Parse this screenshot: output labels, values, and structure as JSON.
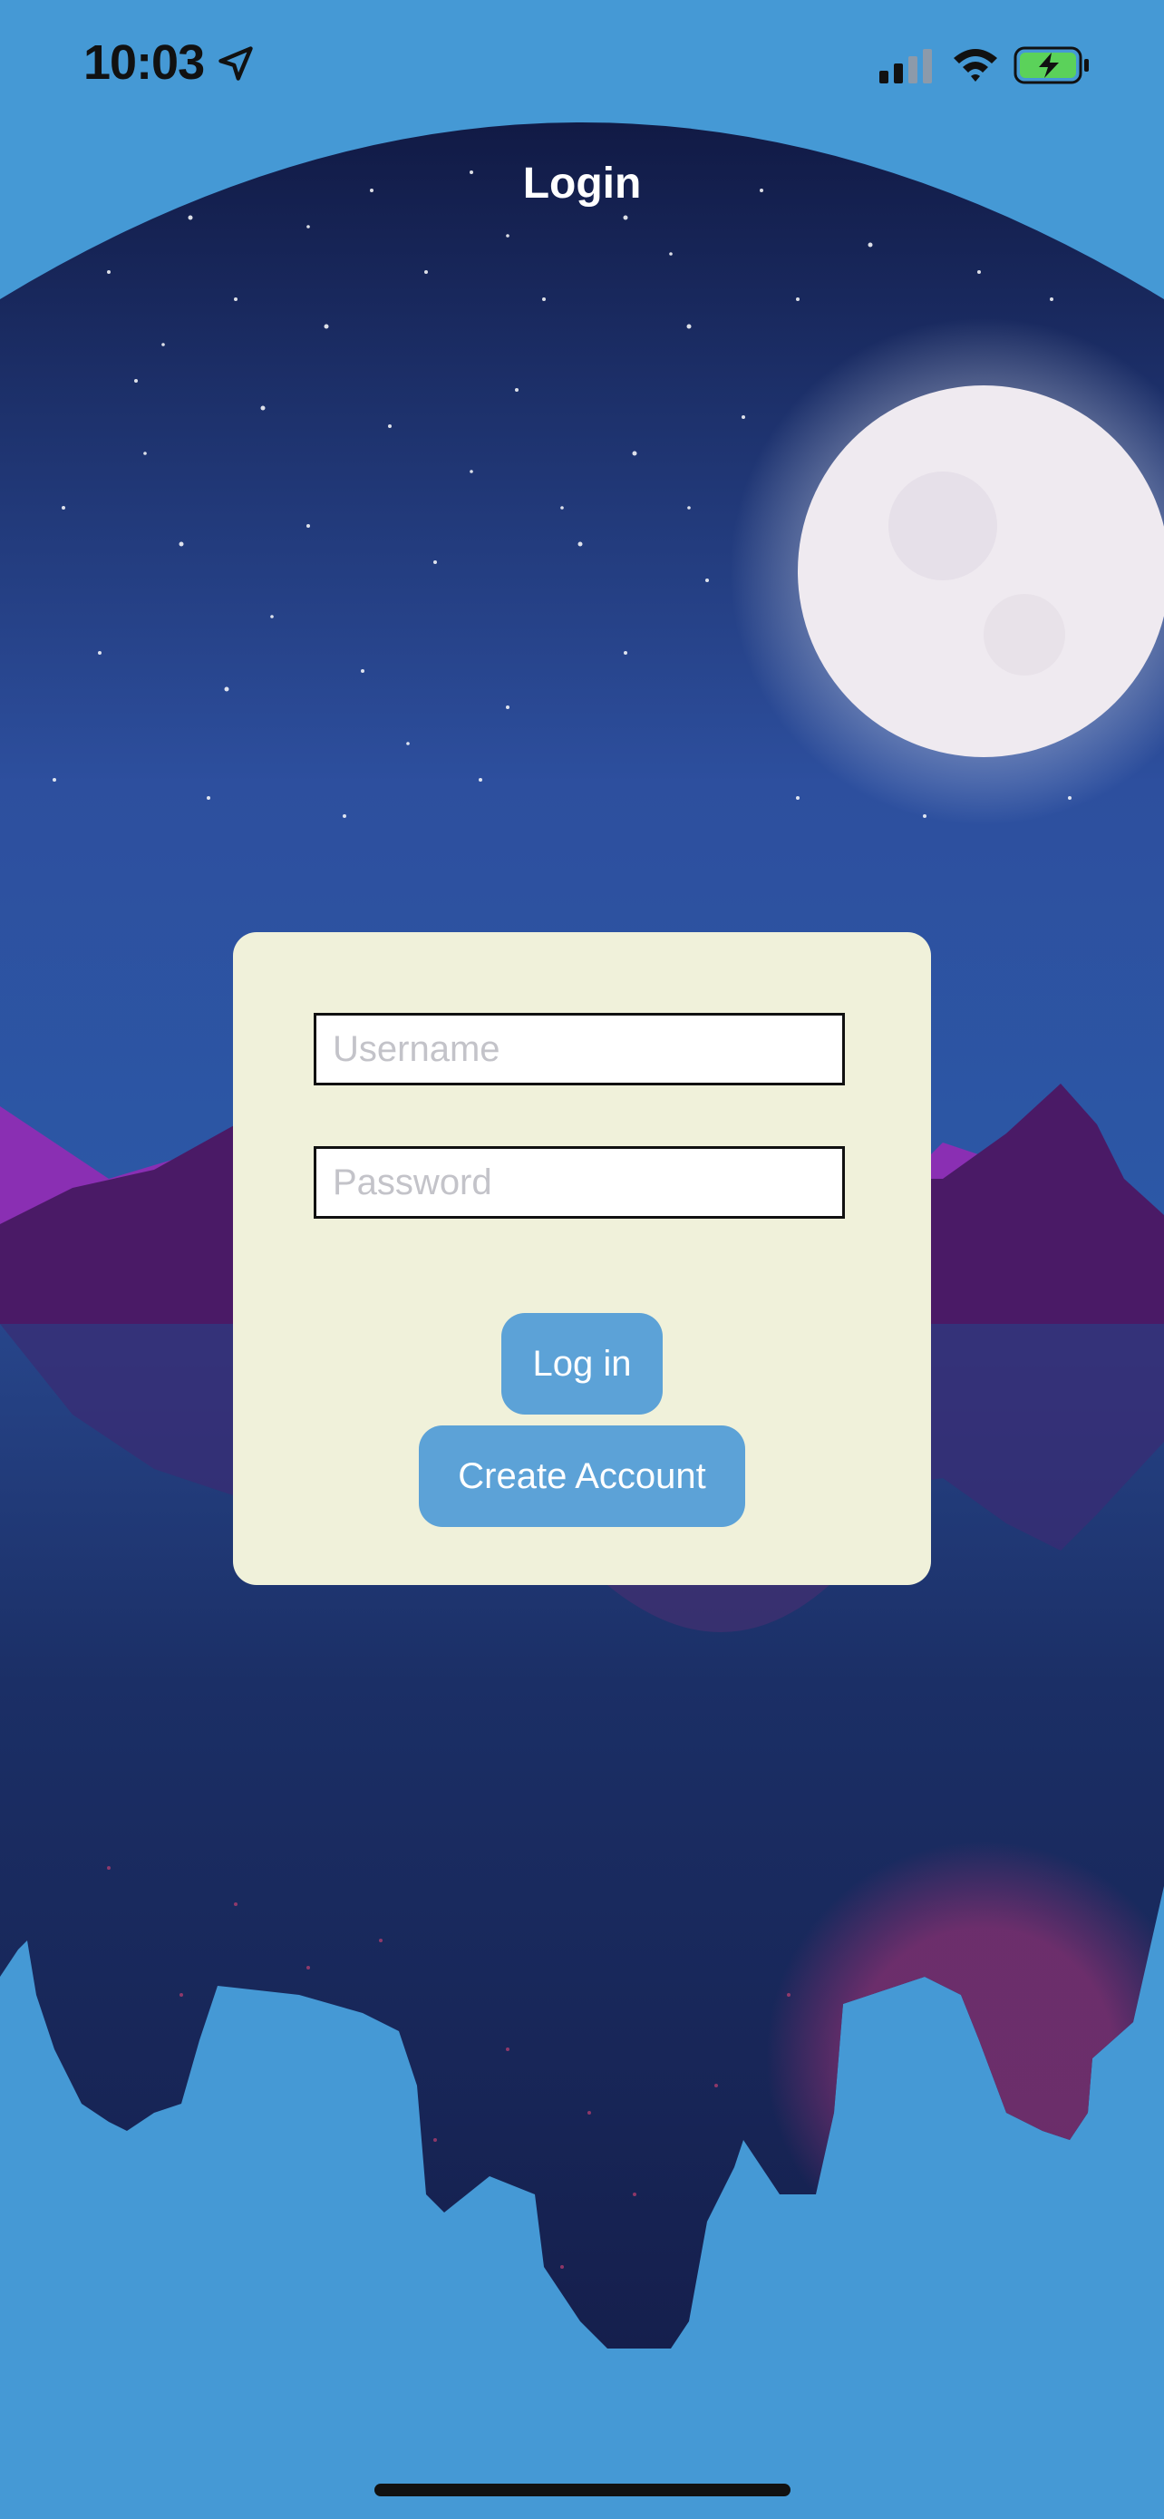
{
  "status_bar": {
    "time": "10:03",
    "location_icon": "location-arrow-icon",
    "signal_icon": "cellular-signal-icon",
    "wifi_icon": "wifi-icon",
    "battery_icon": "battery-charging-icon"
  },
  "nav": {
    "title": "Login"
  },
  "form": {
    "username_placeholder": "Username",
    "username_value": "",
    "password_placeholder": "Password",
    "password_value": "",
    "login_label": "Log in",
    "create_account_label": "Create Account"
  },
  "colors": {
    "page_background": "#4599d5",
    "card_background": "#f0f1da",
    "button_background": "#5ca2d7",
    "night_sky_top": "#111a45",
    "night_sky_bottom": "#2d4f9e",
    "mountain_purple": "#8a2fb3",
    "mountain_dark": "#4a1a66",
    "moon": "#efeaf0"
  }
}
